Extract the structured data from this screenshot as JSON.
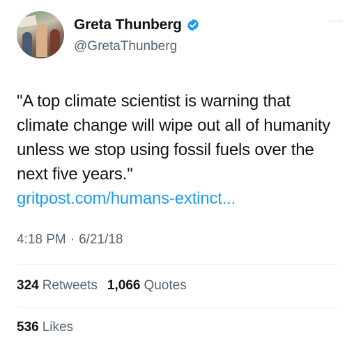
{
  "author": {
    "name": "Greta Thunberg",
    "handle": "@GretaThunberg",
    "verified_color": "#1d9bf0"
  },
  "menu": {
    "more_label": "···"
  },
  "tweet": {
    "text": "\"A top climate scientist is warning that climate change will wipe out all of humanity unless we stop using fossil fuels over the next five years.\"",
    "link_text": "gritpost.com/humans-extinct...",
    "time": "4:18 PM",
    "separator": "·",
    "date": "6/21/18"
  },
  "stats": {
    "retweets_count": "324",
    "retweets_label": "Retweets",
    "quotes_count": "1,066",
    "quotes_label": "Quotes",
    "likes_count": "536",
    "likes_label": "Likes"
  },
  "colors": {
    "text": "#0f1419",
    "secondary": "#536471",
    "link": "#1d9bf0",
    "divider": "#eff3f4"
  }
}
